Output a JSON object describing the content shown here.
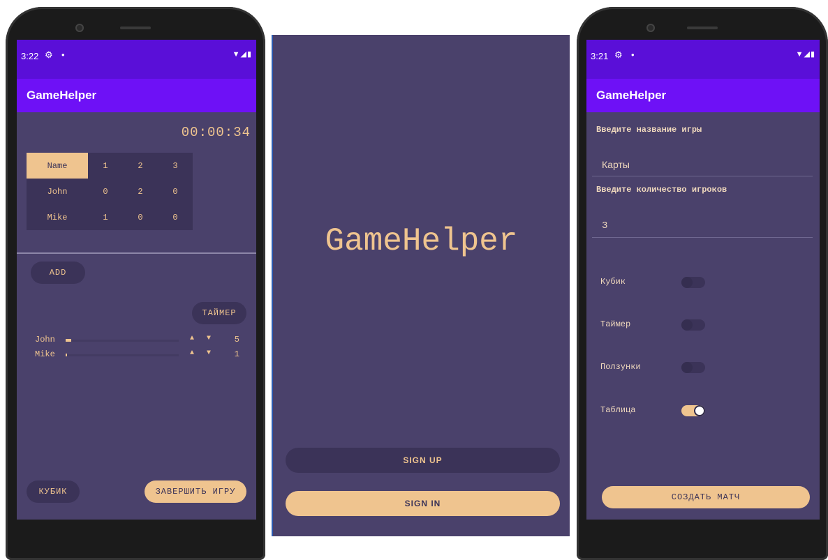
{
  "left_phone": {
    "status": {
      "time": "3:22",
      "gear": "⚙",
      "dot": "•",
      "sys": "▼◢▮"
    },
    "app_title": "GameHelper",
    "timer": "00:00:34",
    "table": {
      "header": [
        "Name",
        "1",
        "2",
        "3"
      ],
      "rows": [
        [
          "John",
          "0",
          "2",
          "0"
        ],
        [
          "Mike",
          "1",
          "0",
          "0"
        ]
      ]
    },
    "add_label": "ADD",
    "timer_button": "ТАЙМЕР",
    "sliders": [
      {
        "name": "John",
        "value": "5",
        "level": 0.05
      },
      {
        "name": "Mike",
        "value": "1",
        "level": 0.01
      }
    ],
    "arrows": "▲ ▼",
    "dice_button": "КУБИК",
    "finish_button": "ЗАВЕРШИТЬ ИГРУ",
    "nav": {
      "back": "◀",
      "home": "●",
      "recent": "■"
    }
  },
  "middle": {
    "title": "GameHelper",
    "sign_up": "SIGN UP",
    "sign_in": "SIGN IN"
  },
  "right_phone": {
    "status": {
      "time": "3:21",
      "gear": "⚙",
      "dot": "•",
      "sys": "▼◢▮"
    },
    "app_title": "GameHelper",
    "game_name_label": "Введите название игры",
    "game_name_value": "Карты",
    "players_label": "Введите количество игроков",
    "players_value": "3",
    "toggles": [
      {
        "label": "Кубик",
        "on": false
      },
      {
        "label": "Таймер",
        "on": false
      },
      {
        "label": "Ползунки",
        "on": false
      },
      {
        "label": "Таблица",
        "on": true
      }
    ],
    "create_button": "СОЗДАТЬ МАТЧ",
    "nav": {
      "back": "◀",
      "home": "●",
      "recent": "■"
    }
  },
  "colors": {
    "peach": "#efc48f",
    "background": "#4a416b",
    "appbar": "#6e11f6",
    "statusbar": "#5a0fd8"
  }
}
